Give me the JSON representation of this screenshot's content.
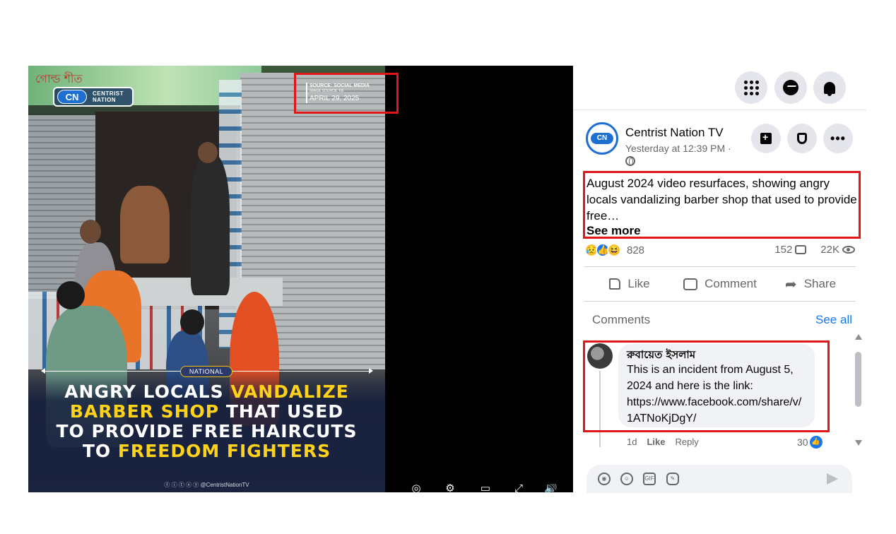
{
  "video": {
    "logo": {
      "mark": "CN",
      "name_line1": "CENTRIST",
      "name_line2": "NATION"
    },
    "shop_sign_text": "গোল্ড শীত",
    "source": {
      "line1": "SOURCE: SOCIAL MEDIA",
      "line2": "IMAGE SOURCE: FB",
      "date": "APRIL 29, 2025"
    },
    "category_badge": "NATIONAL",
    "headline": {
      "w1": "ANGRY LOCALS ",
      "w2": "VANDALIZE",
      "w3": "BARBER SHOP",
      "w4": " THAT USED",
      "w5": "TO PROVIDE FREE HAIRCUTS",
      "w6": "TO ",
      "w7": "FREEDOM FIGHTERS"
    },
    "social_handle": "ⓕ ⓘ ⓣ ⓧ ⓨ @CentristNationTV",
    "colors": {
      "highlight": "#ffd21a",
      "annotation_red": "#e0161b"
    }
  },
  "topbar": {
    "icons": [
      "menu-grid-icon",
      "messenger-icon",
      "notifications-bell-icon"
    ]
  },
  "post": {
    "page_name": "Centrist Nation TV",
    "timestamp": "Yesterday at 12:39 PM ·",
    "avatar_mark": "CN",
    "caption": "August 2024 video resurfaces, showing angry locals vandalizing barber shop that used to provide free…",
    "see_more": "See more",
    "reaction_icons": [
      "😥",
      "👍",
      "😆"
    ],
    "reaction_count": "828",
    "comment_count": "152",
    "view_count": "22K",
    "actions": {
      "like": "Like",
      "comment": "Comment",
      "share": "Share"
    }
  },
  "comments": {
    "label": "Comments",
    "see_all": "See all",
    "items": [
      {
        "author": "রুবায়েত ইসলাম",
        "text": "This is an incident from August 5, 2024 and here is the link:",
        "link": "https://www.facebook.com/share/v/1ATNoKjDgY/",
        "age": "1d",
        "like_label": "Like",
        "reply_label": "Reply",
        "reactions": "30"
      }
    ]
  }
}
